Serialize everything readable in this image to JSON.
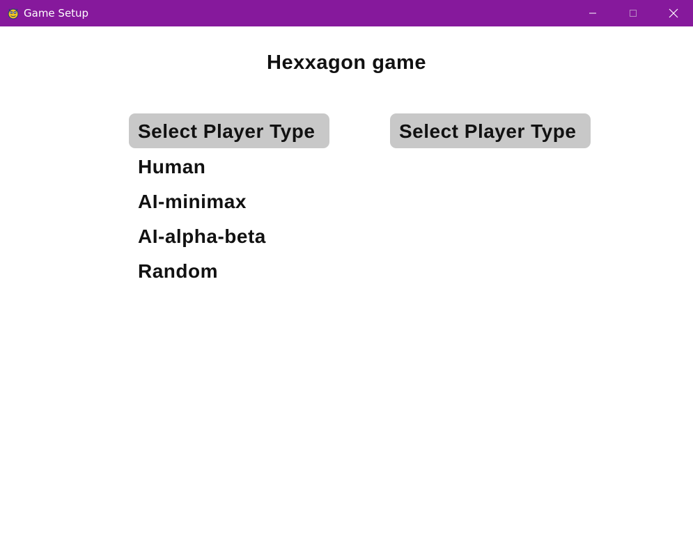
{
  "window": {
    "title": "Game Setup",
    "icon": "pygame-snake-icon",
    "titlebar_color": "#86199c"
  },
  "game": {
    "title": "Hexxagon game"
  },
  "player_selectors": [
    {
      "label": "Select Player Type",
      "expanded": true,
      "options": [
        "Human",
        "AI-minimax",
        "AI-alpha-beta",
        "Random"
      ]
    },
    {
      "label": "Select Player Type",
      "expanded": false
    }
  ],
  "colors": {
    "dropdown_bg": "#c8c8c8",
    "text": "#111111",
    "background": "#ffffff"
  }
}
